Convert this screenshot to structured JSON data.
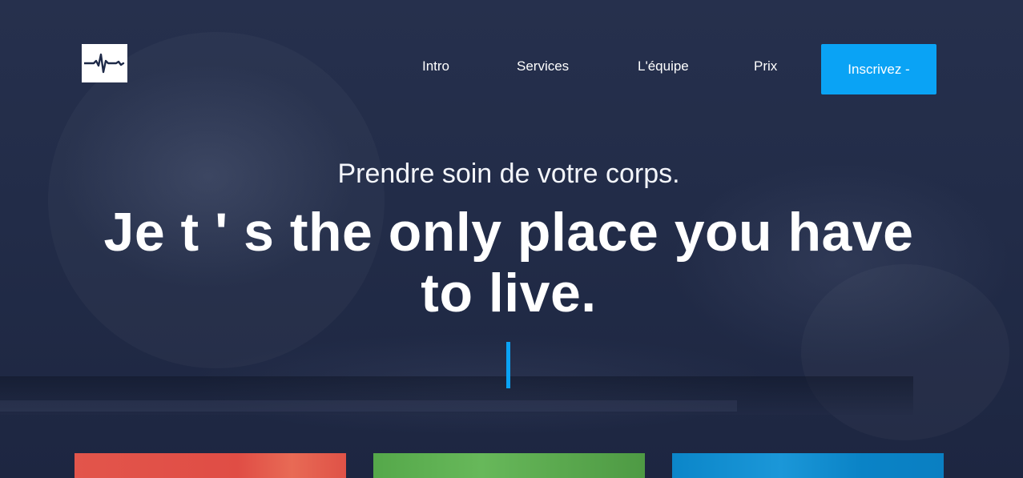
{
  "brand": {
    "logo_icon": "heartbeat-icon"
  },
  "nav": {
    "items": [
      {
        "label": "Intro"
      },
      {
        "label": "Services"
      },
      {
        "label": "L'équipe"
      },
      {
        "label": "Prix"
      }
    ],
    "cta_label": "Inscrivez -"
  },
  "hero": {
    "subtitle": "Prendre soin de votre corps.",
    "title": "Je t ' s the only place you have to live."
  },
  "colors": {
    "accent": "#0aa3f5",
    "background": "#1f2945",
    "card_red": "#e04d45",
    "card_green": "#5aa84e",
    "card_blue": "#0a83c6"
  }
}
